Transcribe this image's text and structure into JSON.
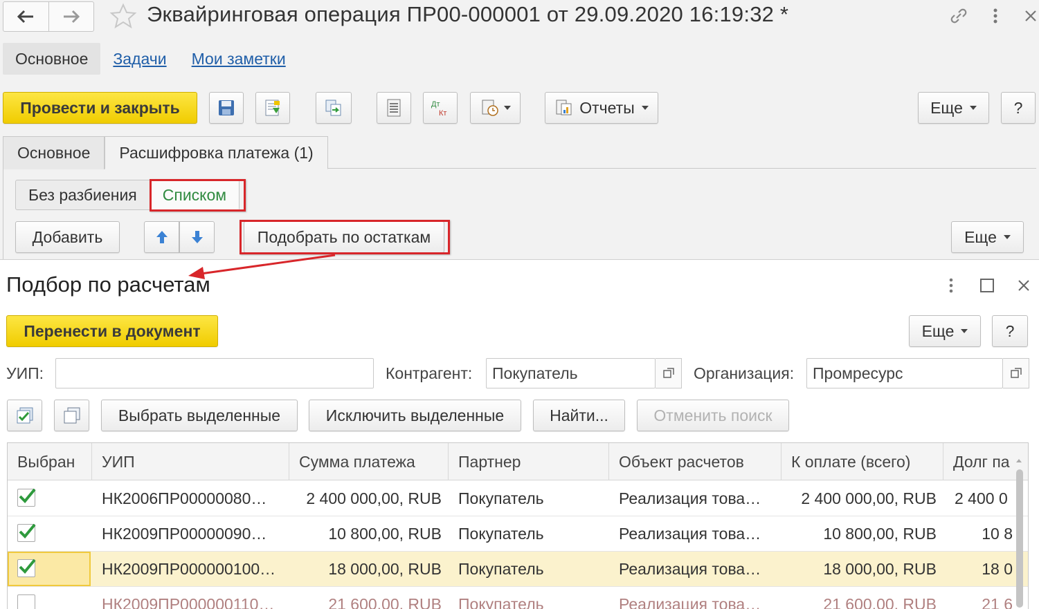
{
  "window": {
    "title": "Эквайринговая операция ПР00-000001 от 29.09.2020 16:19:32 *"
  },
  "section_tabs": [
    "Основное",
    "Задачи",
    "Мои заметки"
  ],
  "toolbar": {
    "post_close": "Провести и закрыть",
    "reports": "Отчеты",
    "more": "Еще",
    "help": "?",
    "dtkt_icon_text": "ДтКт"
  },
  "form_tabs": [
    "Основное",
    "Расшифровка платежа (1)"
  ],
  "split_modes": [
    "Без разбиения",
    "Списком"
  ],
  "panel": {
    "add": "Добавить",
    "select_by_balance": "Подобрать по остаткам",
    "more": "Еще"
  },
  "dialog": {
    "title": "Подбор по расчетам",
    "transfer": "Перенести в документ",
    "more": "Еще",
    "help": "?",
    "filters": {
      "uip_label": "УИП:",
      "uip_value": "",
      "counterparty_label": "Контрагент:",
      "counterparty_value": "Покупатель",
      "org_label": "Организация:",
      "org_value": "Промресурс"
    },
    "actions": {
      "select_marked": "Выбрать выделенные",
      "exclude_marked": "Исключить выделенные",
      "find": "Найти...",
      "cancel_search": "Отменить поиск"
    },
    "table": {
      "columns": [
        "Выбран",
        "УИП",
        "Сумма платежа",
        "Партнер",
        "Объект расчетов",
        "К оплате (всего)",
        "Долг па"
      ],
      "rows": [
        {
          "checked": true,
          "uip": "НК2006ПР00000080…",
          "sum": "2 400 000,00, RUB",
          "partner": "Покупатель",
          "object": "Реализация това…",
          "to_pay": "2 400 000,00, RUB",
          "debt": "2 400 0"
        },
        {
          "checked": true,
          "uip": "НК2009ПР00000090…",
          "sum": "10 800,00, RUB",
          "partner": "Покупатель",
          "object": "Реализация това…",
          "to_pay": "10 800,00, RUB",
          "debt": "10 8"
        },
        {
          "checked": true,
          "uip": "НК2009ПР000000100…",
          "sum": "18 000,00, RUB",
          "partner": "Покупатель",
          "object": "Реализация това…",
          "to_pay": "18 000,00, RUB",
          "debt": "18 0"
        },
        {
          "checked": false,
          "uip": "НК2009ПР000000110…",
          "sum": "21 600,00, RUB",
          "partner": "Покупатель",
          "object": "Реализация това…",
          "to_pay": "21 600,00, RUB",
          "debt": "21 6"
        }
      ]
    }
  },
  "colors": {
    "accent_yellow": "#f5d60a",
    "highlight_red": "#d8262a",
    "active_green": "#2f8a3f",
    "link_blue": "#1f5ea8",
    "selected_row": "#fbf2cd"
  }
}
